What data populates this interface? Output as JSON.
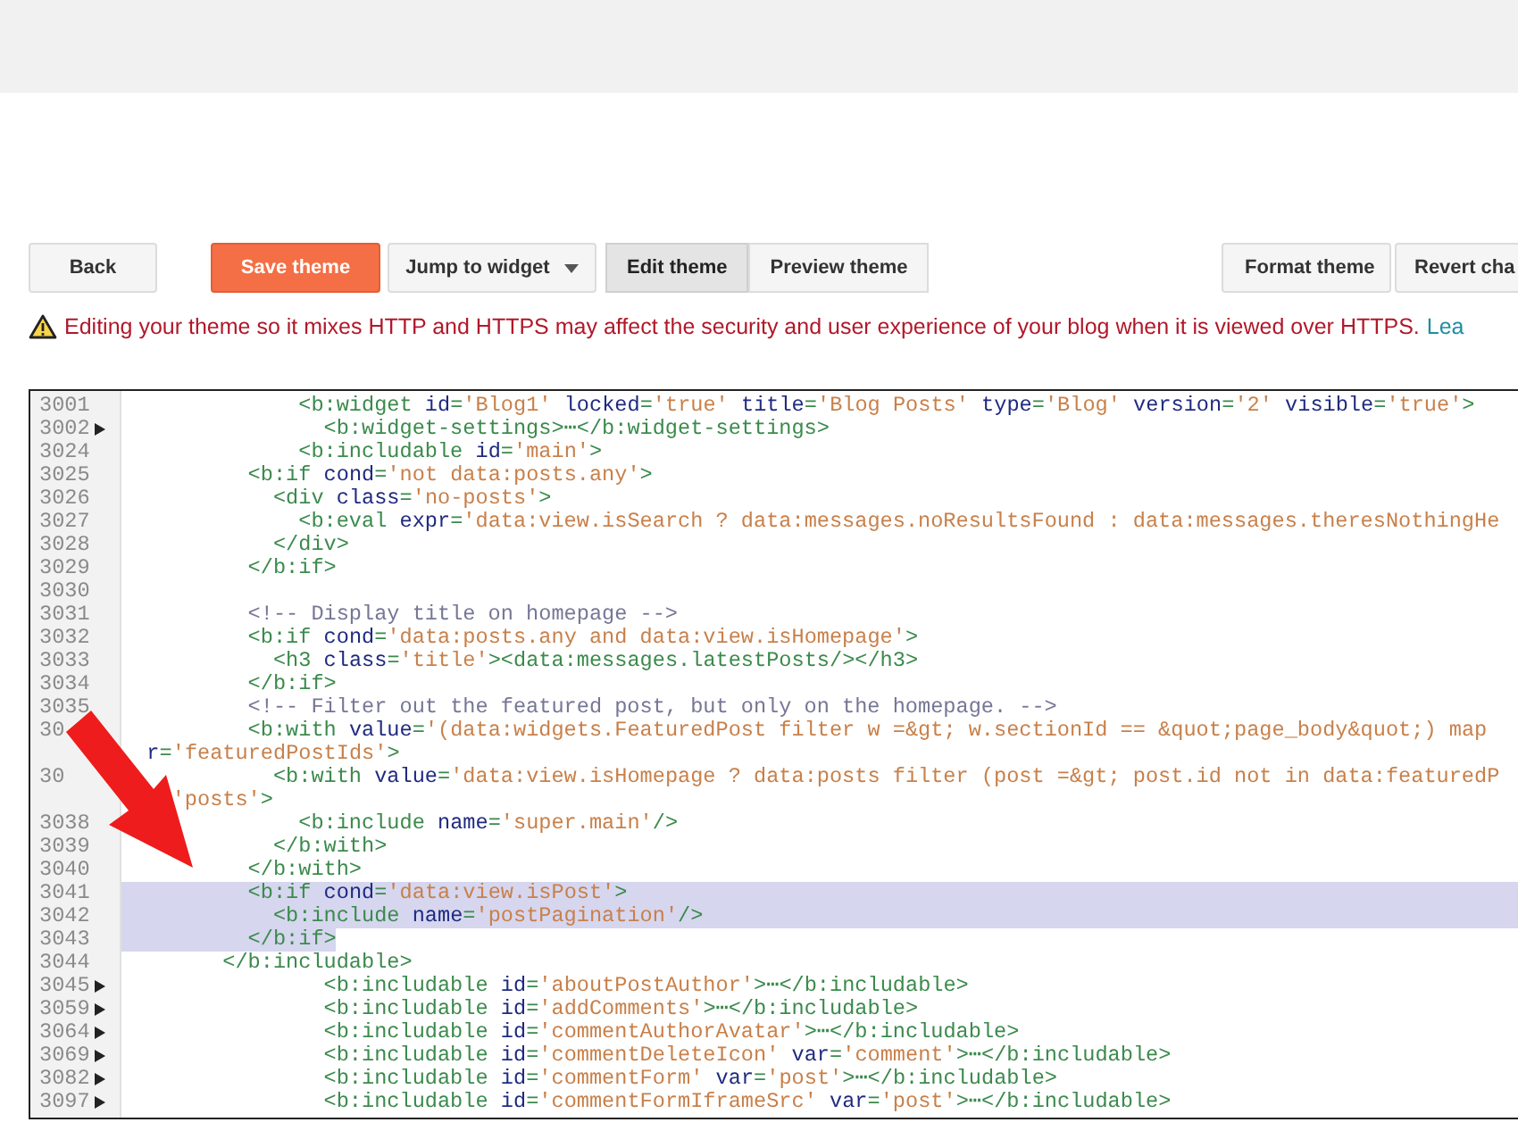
{
  "toolbar": {
    "back": "Back",
    "save": "Save theme",
    "jump": "Jump to widget",
    "tabs": [
      {
        "label": "Edit theme",
        "selected": true
      },
      {
        "label": "Preview theme",
        "selected": false
      }
    ],
    "format": "Format theme",
    "revert": "Revert cha"
  },
  "warning": {
    "text": "Editing your theme so it mixes HTTP and HTTPS may affect the security and user experience of your blog when it is viewed over HTTPS.",
    "link": "Lea"
  },
  "editor": {
    "lines": [
      {
        "number": "3001",
        "folded": false,
        "selected": false,
        "text": "              <b:widget id='Blog1' locked='true' title='Blog Posts' type='Blog' version='2' visible='true'>"
      },
      {
        "number": "3002",
        "folded": true,
        "selected": false,
        "text": "                <b:widget-settings>⋯</b:widget-settings>"
      },
      {
        "number": "3024",
        "folded": false,
        "selected": false,
        "text": "              <b:includable id='main'>"
      },
      {
        "number": "3025",
        "folded": false,
        "selected": false,
        "text": "          <b:if cond='not data:posts.any'>"
      },
      {
        "number": "3026",
        "folded": false,
        "selected": false,
        "text": "            <div class='no-posts'>"
      },
      {
        "number": "3027",
        "folded": false,
        "selected": false,
        "text": "              <b:eval expr='data:view.isSearch ? data:messages.noResultsFound : data:messages.theresNothingHe"
      },
      {
        "number": "3028",
        "folded": false,
        "selected": false,
        "text": "            </div>"
      },
      {
        "number": "3029",
        "folded": false,
        "selected": false,
        "text": "          </b:if>"
      },
      {
        "number": "3030",
        "folded": false,
        "selected": false
      },
      {
        "number": "3031",
        "folded": false,
        "selected": false,
        "text": "          <!-- Display title on homepage -->"
      },
      {
        "number": "3032",
        "folded": false,
        "selected": false,
        "text": "          <b:if cond='data:posts.any and data:view.isHomepage'>"
      },
      {
        "number": "3033",
        "folded": false,
        "selected": false,
        "text": "            <h3 class='title'><data:messages.latestPosts/></h3>"
      },
      {
        "number": "3034",
        "folded": false,
        "selected": false,
        "text": "          </b:if>"
      },
      {
        "number": "3035",
        "folded": false,
        "selected": false,
        "text": "          <!-- Filter out the featured post, but only on the homepage. -->"
      },
      {
        "number": "30",
        "selected": false,
        "text": "          <b:with value='(data:widgets.FeaturedPost filter w =&gt; w.sectionId == &quot;page_body&quot;) map"
      },
      {
        "folded": false,
        "selected": false,
        "text": "  r='featuredPostIds'>"
      },
      {
        "number": "30",
        "folded": false,
        "selected": false,
        "text": "            <b:with value='data:view.isHomepage ? data:posts filter (post =&gt; post.id not in data:featuredP"
      },
      {
        "folded": false,
        "selected": false,
        "text": "    'posts'>"
      },
      {
        "number": "3038",
        "folded": false,
        "selected": false,
        "text": "              <b:include name='super.main'/>"
      },
      {
        "number": "3039",
        "folded": false,
        "selected": false,
        "text": "            </b:with>"
      },
      {
        "number": "3040",
        "folded": false,
        "selected": false,
        "text": "          </b:with>"
      },
      {
        "number": "3041",
        "folded": false,
        "selected": true,
        "text": "          <b:if cond='data:view.isPost'>"
      },
      {
        "number": "3042",
        "folded": false,
        "selected": true,
        "text": "            <b:include name='postPagination'/>"
      },
      {
        "number": "3043",
        "folded": false,
        "selected": true,
        "text": "          </b:if>"
      },
      {
        "number": "3044",
        "folded": false,
        "selected": false,
        "text": "        </b:includable>"
      },
      {
        "number": "3045",
        "folded": true,
        "selected": false,
        "text": "                <b:includable id='aboutPostAuthor'>⋯</b:includable>"
      },
      {
        "number": "3059",
        "folded": true,
        "selected": false,
        "text": "                <b:includable id='addComments'>⋯</b:includable>"
      },
      {
        "number": "3064",
        "folded": true,
        "selected": false,
        "text": "                <b:includable id='commentAuthorAvatar'>⋯</b:includable>"
      },
      {
        "number": "3069",
        "folded": true,
        "selected": false,
        "text": "                <b:includable id='commentDeleteIcon' var='comment'>⋯</b:includable>"
      },
      {
        "number": "3082",
        "folded": true,
        "selected": false,
        "text": "                <b:includable id='commentForm' var='post'>⋯</b:includable>"
      },
      {
        "number": "3097",
        "folded": true,
        "selected": false,
        "text": "                <b:includable id='commentFormIframeSrc' var='post'>⋯</b:includable>"
      }
    ]
  }
}
